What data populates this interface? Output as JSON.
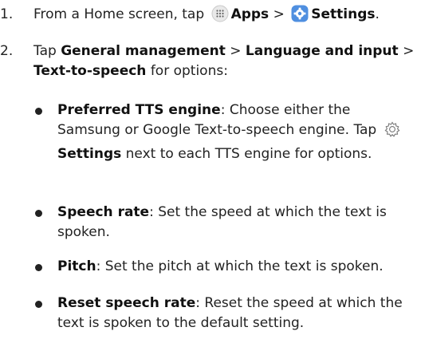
{
  "step1": {
    "number": "1.",
    "prefix": "From a Home screen, tap",
    "apps_label": "Apps",
    "separator": ">",
    "settings_label": "Settings",
    "suffix": "."
  },
  "step2": {
    "number": "2.",
    "tap": "Tap",
    "general_management": "General management",
    "sep1": ">",
    "language_input": "Language and input",
    "sep2": ">",
    "tts": "Text-to-speech",
    "for_options": "for options:"
  },
  "bullets": [
    {
      "term": "Preferred TTS engine",
      "desc": ": Choose either the Samsung or Google Text-to-speech engine.",
      "tap": "Tap",
      "settings": "Settings",
      "tail": "next to each TTS engine for options."
    },
    {
      "term": "Speech rate",
      "desc": ": Set the speed at which the text is spoken."
    },
    {
      "term": "Pitch",
      "desc": ": Set the pitch at which the text is spoken."
    },
    {
      "term": "Reset speech rate",
      "desc": ": Reset the speed at which the text is spoken to the default setting."
    }
  ],
  "icons": {
    "apps": "apps-grid-icon",
    "settings": "settings-gear-icon",
    "gear_outline": "gear-outline-icon"
  },
  "colors": {
    "text": "#222222",
    "settings_icon_bg": "#4f8fe0"
  }
}
